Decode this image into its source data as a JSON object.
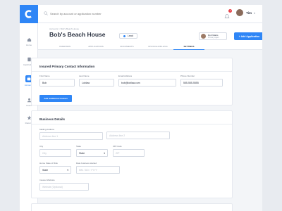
{
  "search": {
    "placeholder": "Search by account or application number"
  },
  "user": {
    "name": "Tim",
    "notifications": "1"
  },
  "sidebar": {
    "items": [
      {
        "label": "Home"
      },
      {
        "label": "Applications"
      },
      {
        "label": "Accounts"
      },
      {
        "label": "Users"
      },
      {
        "label": "Referral"
      }
    ]
  },
  "header": {
    "breadcrumb": "Accounts  >  Bob's Beach House",
    "title": "Bob's Beach House",
    "status": "Lead",
    "agent_name": "Rob Marks",
    "agent_role": "Primary Agent",
    "add_button": "+  Add Application",
    "tabs": [
      {
        "label": "OVERVIEW"
      },
      {
        "label": "APPLICATIONS"
      },
      {
        "label": "DOCUMENTS"
      },
      {
        "label": "INVOICE & BILLING"
      },
      {
        "label": "SETTINGS"
      }
    ]
  },
  "contact": {
    "title": "Insured Primary Contact Information",
    "first_name_label": "First Name",
    "first_name": "Bob",
    "last_name_label": "Last Name",
    "last_name": "Loblaw",
    "email_label": "Email Address",
    "email": "bob@loblaw.com",
    "phone_label": "Phone Number",
    "phone": "555-555-5555",
    "add_button": "Add Additional Contact"
  },
  "business": {
    "title": "Business Details",
    "mailing_label": "Mailing Address",
    "line1_placeholder": "Address line 1",
    "line2_placeholder": "Address line 2",
    "city_label": "City",
    "city_placeholder": "City",
    "state_label": "State",
    "state_value": "State",
    "zip_label": "ZIP Code",
    "zip_placeholder": "ZIP",
    "home_state_label": "Home State of Risk",
    "home_state_value": "State",
    "date_label": "Date business started",
    "date_placeholder": "MM / DD / YYYY",
    "website_label": "Insured Website",
    "website_placeholder": "Website (Optional)"
  },
  "colors": {
    "accent": "#2f86f6",
    "badge": "#e8434a"
  }
}
